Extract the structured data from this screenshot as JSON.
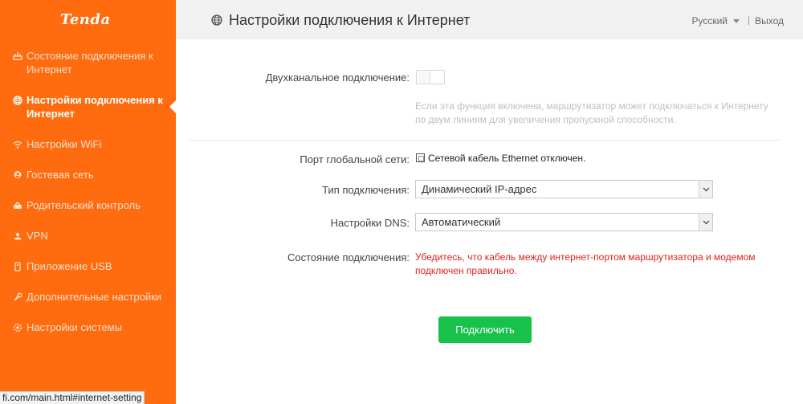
{
  "brand": {
    "logo": "Tenda"
  },
  "sidebar": {
    "items": [
      {
        "label": "Состояние подключения к Интернет",
        "icon": "status-icon",
        "active": false
      },
      {
        "label": "Настройки подключения к Интернет",
        "icon": "globe-icon",
        "active": true
      },
      {
        "label": "Настройки WiFi",
        "icon": "wifi-icon",
        "active": false
      },
      {
        "label": "Гостевая сеть",
        "icon": "guest-icon",
        "active": false
      },
      {
        "label": "Родительский контроль",
        "icon": "parental-icon",
        "active": false
      },
      {
        "label": "VPN",
        "icon": "vpn-icon",
        "active": false
      },
      {
        "label": "Приложение USB",
        "icon": "usb-icon",
        "active": false
      },
      {
        "label": "Дополнительные настройки",
        "icon": "wrench-icon",
        "active": false
      },
      {
        "label": "Настройки системы",
        "icon": "gear-icon",
        "active": false
      }
    ]
  },
  "header": {
    "title": "Настройки подключения к Интернет",
    "language": "Русский",
    "separator": "|",
    "logout": "Выход"
  },
  "form": {
    "dual_label": "Двухканальное подключение:",
    "dual_enabled": false,
    "dual_hint": "Если эта функция включена, маршрутизатор может подключаться к Интернету по двум линиям для увеличения пропускной способности.",
    "wan_label": "Порт глобальной сети:",
    "wan_status": "Сетевой кабель Ethernet отключен.",
    "conn_type_label": "Тип подключения:",
    "conn_type_value": "Динамический IP-адрес",
    "dns_label": "Настройки DNS:",
    "dns_value": "Автоматический",
    "status_label": "Состояние подключения:",
    "status_message": "Убедитесь, что кабель между интернет-портом маршрутизатора и модемом подключен правильно.",
    "connect_button": "Подключить"
  },
  "statusbar": {
    "url": "fi.com/main.html#internet-setting"
  },
  "colors": {
    "sidebar": "#ff6b0f",
    "button": "#17c14a",
    "error": "#e0231c"
  }
}
